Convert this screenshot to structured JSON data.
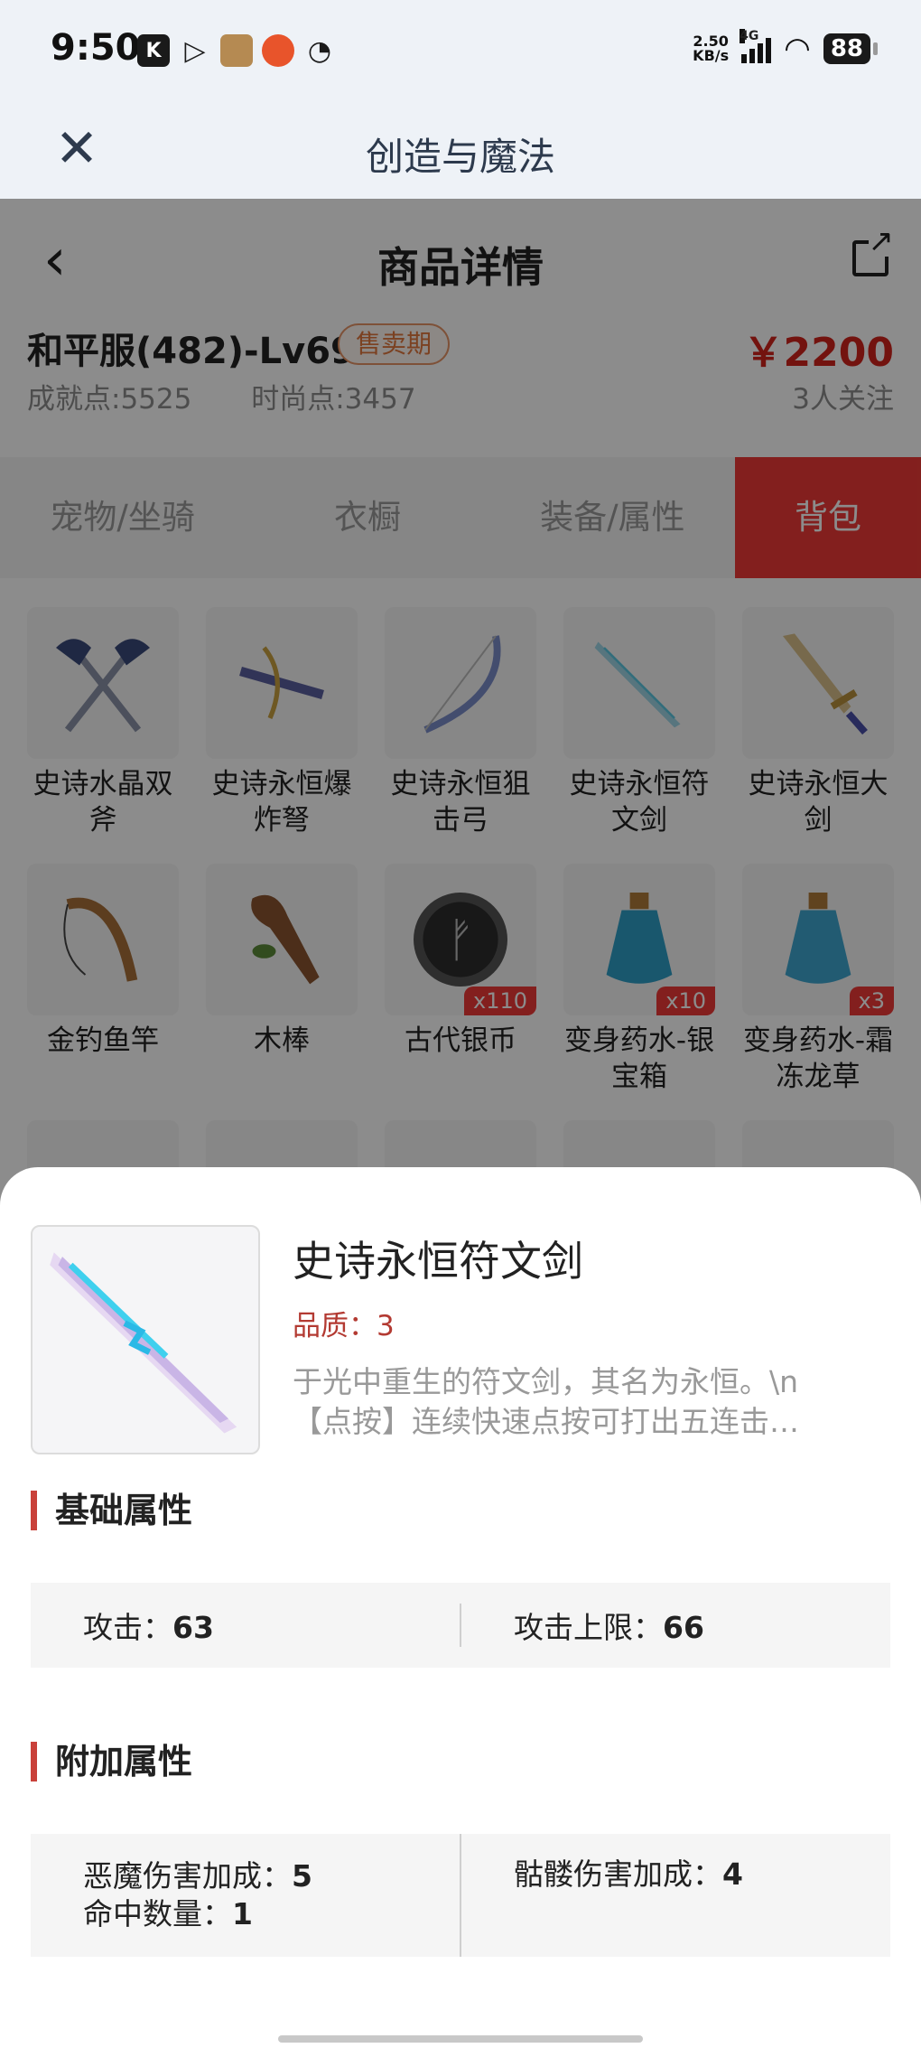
{
  "status_bar": {
    "time": "9:50",
    "net_speed_value": "2.50",
    "net_speed_unit": "KB/s",
    "network": "4G",
    "battery": "88"
  },
  "app_header": {
    "title": "创造与魔法"
  },
  "nav": {
    "title": "商品详情"
  },
  "listing": {
    "server": "和平服(482)-Lv69",
    "badge": "售卖期",
    "price": "￥2200",
    "achievement": "成就点:5525",
    "fashion": "时尚点:3457",
    "watchers": "3人关注"
  },
  "tabs": [
    {
      "label": "宠物/坐骑",
      "active": false
    },
    {
      "label": "衣橱",
      "active": false
    },
    {
      "label": "装备/属性",
      "active": false
    },
    {
      "label": "背包",
      "active": true
    }
  ],
  "items": [
    {
      "name": "史诗水晶双斧",
      "icon": "double-axe-icon",
      "qty": ""
    },
    {
      "name": "史诗永恒爆炸弩",
      "icon": "crossbow-icon",
      "qty": ""
    },
    {
      "name": "史诗永恒狙击弓",
      "icon": "bow-icon",
      "qty": ""
    },
    {
      "name": "史诗永恒符文剑",
      "icon": "rune-sword-icon",
      "qty": ""
    },
    {
      "name": "史诗永恒大剑",
      "icon": "greatsword-icon",
      "qty": ""
    },
    {
      "name": "金钓鱼竿",
      "icon": "fishing-rod-icon",
      "qty": ""
    },
    {
      "name": "木棒",
      "icon": "club-icon",
      "qty": ""
    },
    {
      "name": "古代银币",
      "icon": "silver-coin-icon",
      "qty": "x110"
    },
    {
      "name": "变身药水-银宝箱",
      "icon": "potion-icon",
      "qty": "x10"
    },
    {
      "name": "变身药水-霜冻龙草",
      "icon": "potion-icon",
      "qty": "x3"
    }
  ],
  "detail": {
    "title": "史诗永恒符文剑",
    "quality": "品质：3",
    "desc_line1": "于光中重生的符文剑，其名为永恒。\\n",
    "desc_line2": "【点按】连续快速点按可打出五连击…",
    "base_section": "基础属性",
    "base_attrs": [
      {
        "label": "攻击：",
        "value": "63"
      },
      {
        "label": "攻击上限：",
        "value": "66"
      }
    ],
    "extra_section": "附加属性",
    "extra_attrs": [
      {
        "label": "恶魔伤害加成：",
        "value": "5"
      },
      {
        "label": "命中数量：",
        "value": "1"
      },
      {
        "label": "骷髅伤害加成：",
        "value": "4"
      }
    ]
  },
  "colors": {
    "accent_red": "#ee3a37",
    "price_red": "#d2241d",
    "quality_red": "#b33a32",
    "badge_orange": "#e0773d"
  }
}
